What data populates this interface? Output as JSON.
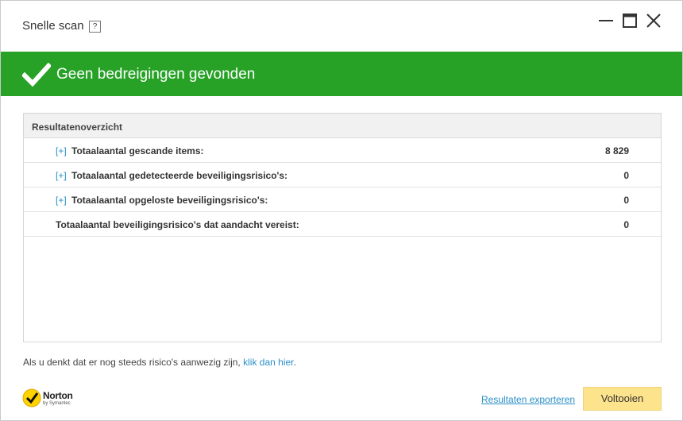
{
  "window": {
    "title": "Snelle scan",
    "help_label": "?"
  },
  "banner": {
    "message": "Geen bedreigingen gevonden",
    "color": "#27a227"
  },
  "results": {
    "header": "Resultatenoverzicht",
    "rows": [
      {
        "expander": "[+]",
        "label": "Totaalaantal gescande items:",
        "value": "8 829"
      },
      {
        "expander": "[+]",
        "label": "Totaalaantal gedetecteerde beveiligingsrisico's:",
        "value": "0"
      },
      {
        "expander": "[+]",
        "label": "Totaalaantal opgeloste beveiligingsrisico's:",
        "value": "0"
      },
      {
        "label": "Totaalaantal beveiligingsrisico's dat aandacht vereist:",
        "value": "0"
      }
    ]
  },
  "footnote": {
    "text": "Als u denkt dat er nog steeds risico's aanwezig zijn,",
    "link": "klik dan hier",
    "suffix": "."
  },
  "logo": {
    "brand": "Norton",
    "by": "by Symantec"
  },
  "actions": {
    "export_label": "Resultaten exporteren",
    "done_label": "Voltooien"
  },
  "colors": {
    "link": "#2a8fc8",
    "done_button": "#fde38c"
  }
}
